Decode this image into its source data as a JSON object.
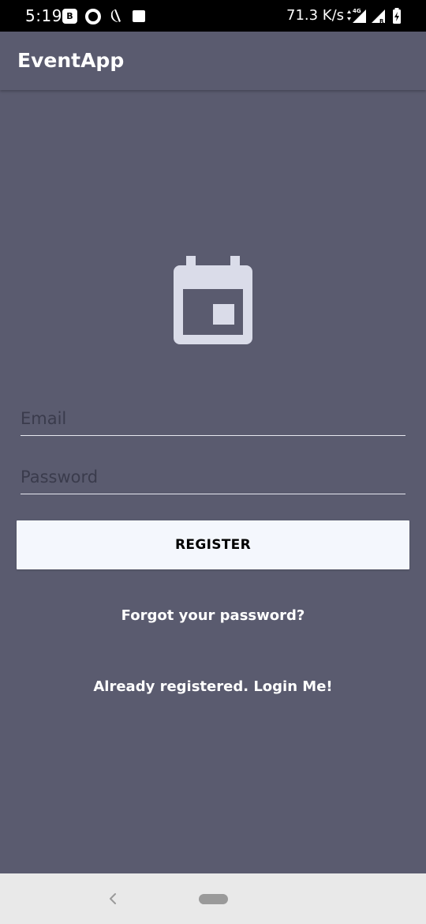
{
  "status_bar": {
    "time": "5:19",
    "b_badge": "B",
    "network_speed": "71.3 K/s",
    "network_type": "4G",
    "roaming_label": "R",
    "icons": [
      "b-badge-icon",
      "circle-icon",
      "moon-icon",
      "image-icon",
      "data-arrows-icon",
      "signal-icon",
      "signal-roaming-icon",
      "battery-charging-icon"
    ]
  },
  "app_bar": {
    "title": "EventApp"
  },
  "form": {
    "icon": "calendar-icon",
    "email_placeholder": "Email",
    "email_value": "",
    "password_placeholder": "Password",
    "password_value": "",
    "register_label": "REGISTER",
    "forgot_password_label": "Forgot your password?",
    "login_label": "Already registered. Login Me!"
  },
  "nav_bar": {
    "icons": [
      "back-icon",
      "home-pill-icon"
    ]
  },
  "colors": {
    "background": "#5a5b6f",
    "button_background": "#f4f7fd",
    "icon_color": "#dadce9",
    "status_bar": "#000000",
    "nav_bar": "#e9e9e9"
  }
}
